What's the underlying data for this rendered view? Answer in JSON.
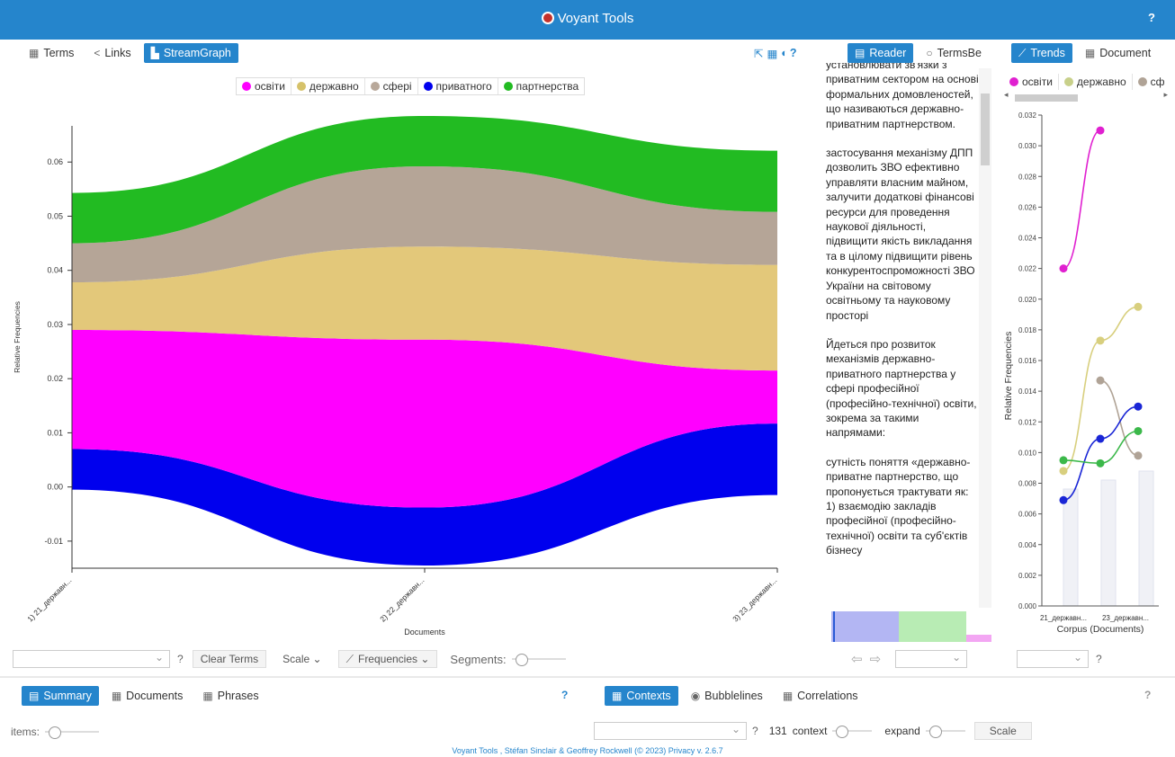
{
  "app": {
    "title": "Voyant Tools",
    "help": "?"
  },
  "left_panel": {
    "tabs": [
      {
        "label": "Terms",
        "active": false,
        "icon": "table-icon"
      },
      {
        "label": "Links",
        "active": false,
        "icon": "share-icon"
      },
      {
        "label": "StreamGraph",
        "active": true,
        "icon": "streamgraph-icon"
      }
    ],
    "header_tools": {
      "export": "export-icon",
      "tools": "grid-icon",
      "toggle": "toggle-icon",
      "help": "?"
    },
    "legend": [
      {
        "label": "освіти",
        "color": "#ff00ff"
      },
      {
        "label": "державно",
        "color": "#d6c26a"
      },
      {
        "label": "сфері",
        "color": "#b8a89a"
      },
      {
        "label": "приватного",
        "color": "#0000ee"
      },
      {
        "label": "партнерства",
        "color": "#22bb22"
      }
    ],
    "footer_controls": {
      "combo_value": "",
      "help": "?",
      "clear_terms": "Clear Terms",
      "scale": "Scale",
      "frequencies": "Frequencies",
      "segments": "Segments:"
    }
  },
  "chart_data": [
    {
      "type": "area",
      "title": "",
      "xlabel": "Documents",
      "ylabel": "Relative Frequencies",
      "categories": [
        "1) 21_державн...",
        "2) 22_державн...",
        "3) 23_державн..."
      ],
      "ylim": [
        -0.015,
        0.07
      ],
      "y_ticks": [
        -0.01,
        0.0,
        0.01,
        0.02,
        0.03,
        0.04,
        0.05,
        0.06
      ],
      "baseline": [
        -0.0005,
        -0.0145,
        -0.0015
      ],
      "series": [
        {
          "name": "приватного",
          "color": "#0000ee",
          "values": [
            0.0075,
            0.0107,
            0.0132
          ]
        },
        {
          "name": "освіти",
          "color": "#ff00ff",
          "values": [
            0.022,
            0.031,
            0.0098
          ]
        },
        {
          "name": "державно",
          "color": "#e3c87a",
          "values": [
            0.0088,
            0.0172,
            0.0195
          ]
        },
        {
          "name": "сфері",
          "color": "#b5a597",
          "values": [
            0.0072,
            0.0148,
            0.0098
          ]
        },
        {
          "name": "партнерства",
          "color": "#22bb22",
          "values": [
            0.0093,
            0.0093,
            0.0113
          ]
        }
      ]
    },
    {
      "type": "line",
      "title": "",
      "xlabel": "Corpus (Documents)",
      "ylabel": "Relative Frequencies",
      "categories": [
        "21_державн...",
        "",
        "23_державн..."
      ],
      "ylim": [
        0.0,
        0.032
      ],
      "y_ticks": [
        "0.000",
        "0.002",
        "0.004",
        "0.006",
        "0.008",
        "0.010",
        "0.012",
        "0.014",
        "0.016",
        "0.018",
        "0.020",
        "0.022",
        "0.024",
        "0.026",
        "0.028",
        "0.030",
        "0.032"
      ],
      "series": [
        {
          "name": "освіти",
          "color": "#e020d0",
          "values": [
            0.022,
            0.031,
            null
          ]
        },
        {
          "name": "державно",
          "color": "#d8cf7e",
          "values": [
            0.0088,
            0.0173,
            0.0195
          ]
        },
        {
          "name": "сфері",
          "color": "#b0a396",
          "values": [
            null,
            0.0147,
            0.0098
          ]
        },
        {
          "name": "приватного",
          "color": "#1a26d6",
          "values": [
            0.0069,
            0.0109,
            0.013
          ]
        },
        {
          "name": "партнерства",
          "color": "#3bb84a",
          "values": [
            0.0095,
            0.0093,
            0.0114
          ]
        }
      ]
    }
  ],
  "middle_panel": {
    "tabs": [
      {
        "label": "Reader",
        "active": true,
        "icon": "reader-icon"
      },
      {
        "label": "TermsBe",
        "active": false,
        "icon": "termsberry-icon"
      }
    ],
    "paragraphs": [
      "установлювати зв'язки з приватним сектором на основі формальних домовленостей, що називаються державно-приватним партнерством.",
      "застосування механізму ДПП дозволить ЗВО ефективно управляти власним майном, залучити додаткові фінансові ресурси для проведення наукової діяльності, підвищити якість викладання та в цілому підвищити рівень конкурентоспроможності ЗВО України на світовому освітньому та науковому просторі",
      "Йдеться про розвиток механізмів державно-приватного партнерства у сфері професійної (професійно-технічної) освіти, зокрема за такими напрямами:",
      "сутність поняття «державно-приватне партнерство, що пропонується трактувати як: 1) взаємодію закладів професійної (професійно-технічної) освіти та суб'єктів бізнесу"
    ]
  },
  "right_panel": {
    "tabs": [
      {
        "label": "Trends",
        "active": true,
        "icon": "trends-icon"
      },
      {
        "label": "Document",
        "active": false,
        "icon": "table-icon"
      }
    ],
    "legend": [
      {
        "label": "освіти",
        "color": "#e020d0"
      },
      {
        "label": "державно",
        "color": "#c8d08a"
      },
      {
        "label": "сф",
        "color": "#b0a396"
      }
    ],
    "help": "?"
  },
  "bottom_left": {
    "tabs": [
      {
        "label": "Summary",
        "active": true,
        "icon": "summary-icon"
      },
      {
        "label": "Documents",
        "active": false,
        "icon": "table-icon"
      },
      {
        "label": "Phrases",
        "active": false,
        "icon": "table-icon"
      }
    ],
    "help": "?",
    "items_label": "items:"
  },
  "bottom_right": {
    "tabs": [
      {
        "label": "Contexts",
        "active": true,
        "icon": "table-icon"
      },
      {
        "label": "Bubblelines",
        "active": false,
        "icon": "eye-icon"
      },
      {
        "label": "Correlations",
        "active": false,
        "icon": "table-icon"
      }
    ],
    "help": "?",
    "context_count": "131",
    "context_label": "context",
    "expand_label": "expand",
    "scale": "Scale"
  },
  "footer": {
    "text": "Voyant Tools , Stéfan Sinclair & Geoffrey Rockwell (© 2023) Privacy v. 2.6.7"
  }
}
